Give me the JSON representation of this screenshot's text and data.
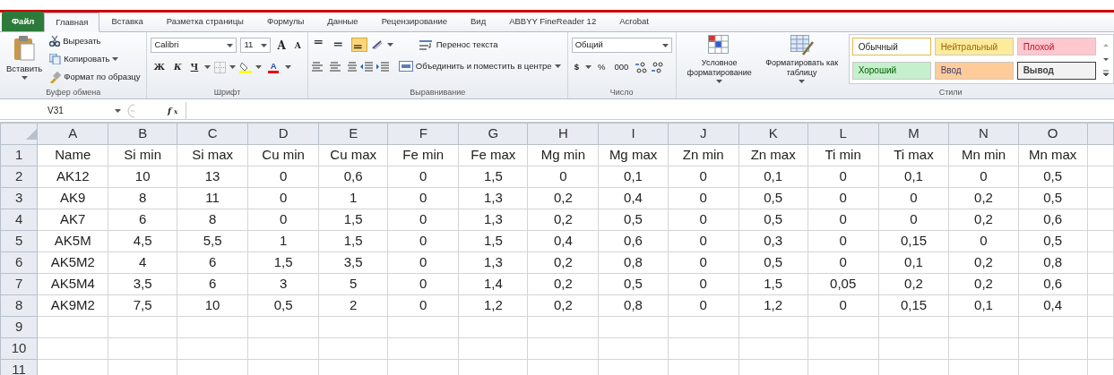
{
  "tabs": [
    {
      "label": "Файл",
      "kind": "file",
      "selected": false
    },
    {
      "label": "Главная",
      "kind": "tab",
      "selected": true
    },
    {
      "label": "Вставка",
      "kind": "tab",
      "selected": false
    },
    {
      "label": "Разметка страницы",
      "kind": "tab",
      "selected": false
    },
    {
      "label": "Формулы",
      "kind": "tab",
      "selected": false
    },
    {
      "label": "Данные",
      "kind": "tab",
      "selected": false
    },
    {
      "label": "Рецензирование",
      "kind": "tab",
      "selected": false
    },
    {
      "label": "Вид",
      "kind": "tab",
      "selected": false
    },
    {
      "label": "ABBYY FineReader 12",
      "kind": "tab",
      "selected": false
    },
    {
      "label": "Acrobat",
      "kind": "tab",
      "selected": false
    }
  ],
  "ribbon": {
    "clipboard": {
      "paste": "Вставить",
      "cut": "Вырезать",
      "copy": "Копировать",
      "format_painter": "Формат по образцу",
      "label": "Буфер обмена"
    },
    "font": {
      "name": "Calibri",
      "size": "11",
      "grow": "A",
      "shrink": "A",
      "bold": "Ж",
      "italic": "К",
      "underline": "Ч",
      "font_color": "A",
      "label": "Шрифт"
    },
    "alignment": {
      "vertical": [
        {
          "selected": false
        },
        {
          "selected": false
        },
        {
          "selected": true
        }
      ],
      "wrap": "Перенос текста",
      "merge": "Объединить и поместить в центре",
      "label": "Выравнивание"
    },
    "number": {
      "format": "Общий",
      "currency": "$",
      "percent": "%",
      "thousands": "000",
      "label": "Число"
    },
    "styles": {
      "conditional": "Условное форматирование",
      "as_table": "Форматировать как таблицу",
      "label": "Стили",
      "gallery": [
        {
          "label": "Обычный",
          "color": "#ffffff",
          "selected": true
        },
        {
          "label": "Нейтральный",
          "color": "#ffeb9c",
          "selected": false
        },
        {
          "label": "Плохой",
          "color": "#ffc7ce",
          "selected": false
        },
        {
          "label": "Хороший",
          "color": "#c6efce",
          "selected": false
        },
        {
          "label": "Ввод",
          "color": "#ffcc99",
          "selected": false
        },
        {
          "label": "Вывод",
          "color": "#f2f2f2",
          "selected": false
        }
      ]
    }
  },
  "formula_bar": {
    "name_box": "V31",
    "fx": "f$_{x}$"
  },
  "sheet": {
    "columns": [
      "A",
      "B",
      "C",
      "D",
      "E",
      "F",
      "G",
      "H",
      "I",
      "J",
      "K",
      "L",
      "M",
      "N",
      "O"
    ],
    "rows": [
      {
        "number": "1",
        "cells": [
          "Name",
          "Si min",
          "Si max",
          "Cu min",
          "Cu max",
          "Fe min",
          "Fe max",
          "Mg min",
          "Mg max",
          "Zn min",
          "Zn max",
          "Ti min",
          "Ti max",
          "Mn min",
          "Mn max"
        ]
      },
      {
        "number": "2",
        "cells": [
          "AK12",
          "10",
          "13",
          "0",
          "0,6",
          "0",
          "1,5",
          "0",
          "0,1",
          "0",
          "0,1",
          "0",
          "0,1",
          "0",
          "0,5"
        ]
      },
      {
        "number": "3",
        "cells": [
          "AK9",
          "8",
          "11",
          "0",
          "1",
          "0",
          "1,3",
          "0,2",
          "0,4",
          "0",
          "0,5",
          "0",
          "0",
          "0,2",
          "0,5"
        ]
      },
      {
        "number": "4",
        "cells": [
          "AK7",
          "6",
          "8",
          "0",
          "1,5",
          "0",
          "1,3",
          "0,2",
          "0,5",
          "0",
          "0,5",
          "0",
          "0",
          "0,2",
          "0,6"
        ]
      },
      {
        "number": "5",
        "cells": [
          "AK5M",
          "4,5",
          "5,5",
          "1",
          "1,5",
          "0",
          "1,5",
          "0,4",
          "0,6",
          "0",
          "0,3",
          "0",
          "0,15",
          "0",
          "0,5"
        ]
      },
      {
        "number": "6",
        "cells": [
          "AK5M2",
          "4",
          "6",
          "1,5",
          "3,5",
          "0",
          "1,3",
          "0,2",
          "0,8",
          "0",
          "0,5",
          "0",
          "0,1",
          "0,2",
          "0,8"
        ]
      },
      {
        "number": "7",
        "cells": [
          "AK5M4",
          "3,5",
          "6",
          "3",
          "5",
          "0",
          "1,4",
          "0,2",
          "0,5",
          "0",
          "1,5",
          "0,05",
          "0,2",
          "0,2",
          "0,6"
        ]
      },
      {
        "number": "8",
        "cells": [
          "AK9M2",
          "7,5",
          "10",
          "0,5",
          "2",
          "0",
          "1,2",
          "0,2",
          "0,8",
          "0",
          "1,2",
          "0",
          "0,15",
          "0,1",
          "0,4"
        ]
      },
      {
        "number": "9"
      },
      {
        "number": "10"
      },
      {
        "number": "11"
      }
    ]
  }
}
